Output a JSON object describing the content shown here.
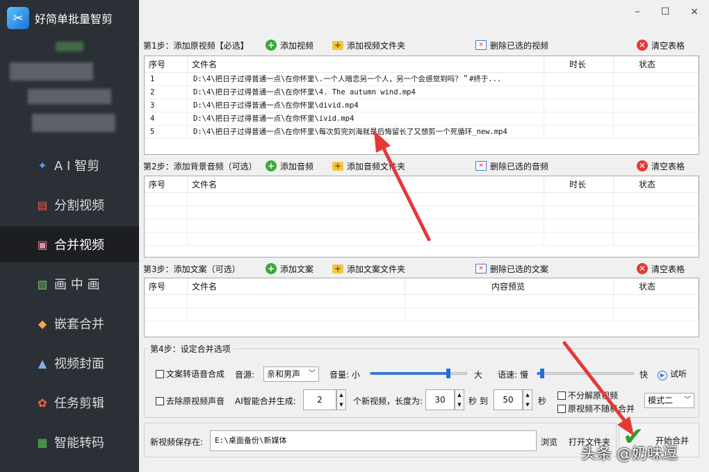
{
  "app": {
    "title": "好简单批量智剪"
  },
  "window_controls": {
    "minimize": "–",
    "maximize": "☐",
    "close": "×"
  },
  "sidebar": {
    "items": [
      {
        "label": "A I 智剪",
        "icon": "ai-cut-icon"
      },
      {
        "label": "分割视频",
        "icon": "split-video-icon"
      },
      {
        "label": "合并视频",
        "icon": "merge-video-icon",
        "active": true
      },
      {
        "label": "画 中 画",
        "icon": "picture-in-picture-icon"
      },
      {
        "label": "嵌套合并",
        "icon": "nested-merge-icon"
      },
      {
        "label": "视频封面",
        "icon": "video-cover-icon"
      },
      {
        "label": "任务剪辑",
        "icon": "task-edit-icon"
      },
      {
        "label": "智能转码",
        "icon": "smart-transcode-icon"
      }
    ]
  },
  "step1": {
    "label": "第1步：添加原视频【必选】",
    "add": "添加视频",
    "add_folder": "添加视频文件夹",
    "delete": "删除已选的视频",
    "clear": "清空表格",
    "headers": [
      "序号",
      "文件名",
      "时长",
      "状态"
    ],
    "rows": [
      {
        "no": "1",
        "name": "D:\\4\\把日子过得普通一点\\在你怀里\\.一个人暗恋另一个人，另一个会感觉到吗？＂#终于...",
        "dur": "",
        "status": ""
      },
      {
        "no": "2",
        "name": "D:\\4\\把日子过得普通一点\\在你怀里\\4. The autumn wind.mp4",
        "dur": "",
        "status": ""
      },
      {
        "no": "3",
        "name": "D:\\4\\把日子过得普通一点\\在你怀里\\divid.mp4",
        "dur": "",
        "status": ""
      },
      {
        "no": "4",
        "name": "D:\\4\\把日子过得普通一点\\在你怀里\\ivid.mp4",
        "dur": "",
        "status": ""
      },
      {
        "no": "5",
        "name": "D:\\4\\把日子过得普通一点\\在你怀里\\每次剪完刘海就是后悔留长了又想剪一个死循环_new.mp4",
        "dur": "",
        "status": ""
      }
    ]
  },
  "step2": {
    "label": "第2步：添加背景音频（可选）",
    "add": "添加音频",
    "add_folder": "添加音频文件夹",
    "delete": "删除已选的音频",
    "clear": "清空表格",
    "headers": [
      "序号",
      "文件名",
      "时长",
      "状态"
    ]
  },
  "step3": {
    "label": "第3步：添加文案（可选）",
    "add": "添加文案",
    "add_folder": "添加文案文件夹",
    "delete": "删除已选的文案",
    "clear": "清空表格",
    "headers": [
      "序号",
      "文件名",
      "内容预览",
      "状态"
    ]
  },
  "step4": {
    "label": "第4步：设定合并选项",
    "tts": "文案转语音合成",
    "voice_label": "音源:",
    "voice_value": "亲和男声",
    "volume_label": "音量: 小",
    "volume_max": "大",
    "volume_level": 0.8,
    "speed_label": "语速: 慢",
    "speed_max": "快",
    "speed_level": 0.05,
    "try_listen": "试听",
    "remove_audio": "去除原视频声音",
    "ai_gen_label": "AI智能合并生成:",
    "ai_gen_value": "2",
    "new_video_label": "个新视频，长度为:",
    "len_min": "30",
    "sec_to": "秒 到",
    "len_max": "50",
    "sec": "秒",
    "no_decompose": "不分解原视频",
    "no_random": "原视频不随机合并",
    "mode_value": "模式二"
  },
  "save": {
    "label": "新视频保存在:",
    "path": "E:\\桌面备份\\新媒体",
    "browse": "浏览",
    "open_folder": "打开文件夹",
    "start": "开始合并"
  },
  "watermark": "头条 @奶味逗",
  "colors": {
    "sidebar_bg": "#2b2f36",
    "active_bg": "#1c1e22",
    "arrow": "#e53935",
    "check": "#2a9d2a"
  }
}
